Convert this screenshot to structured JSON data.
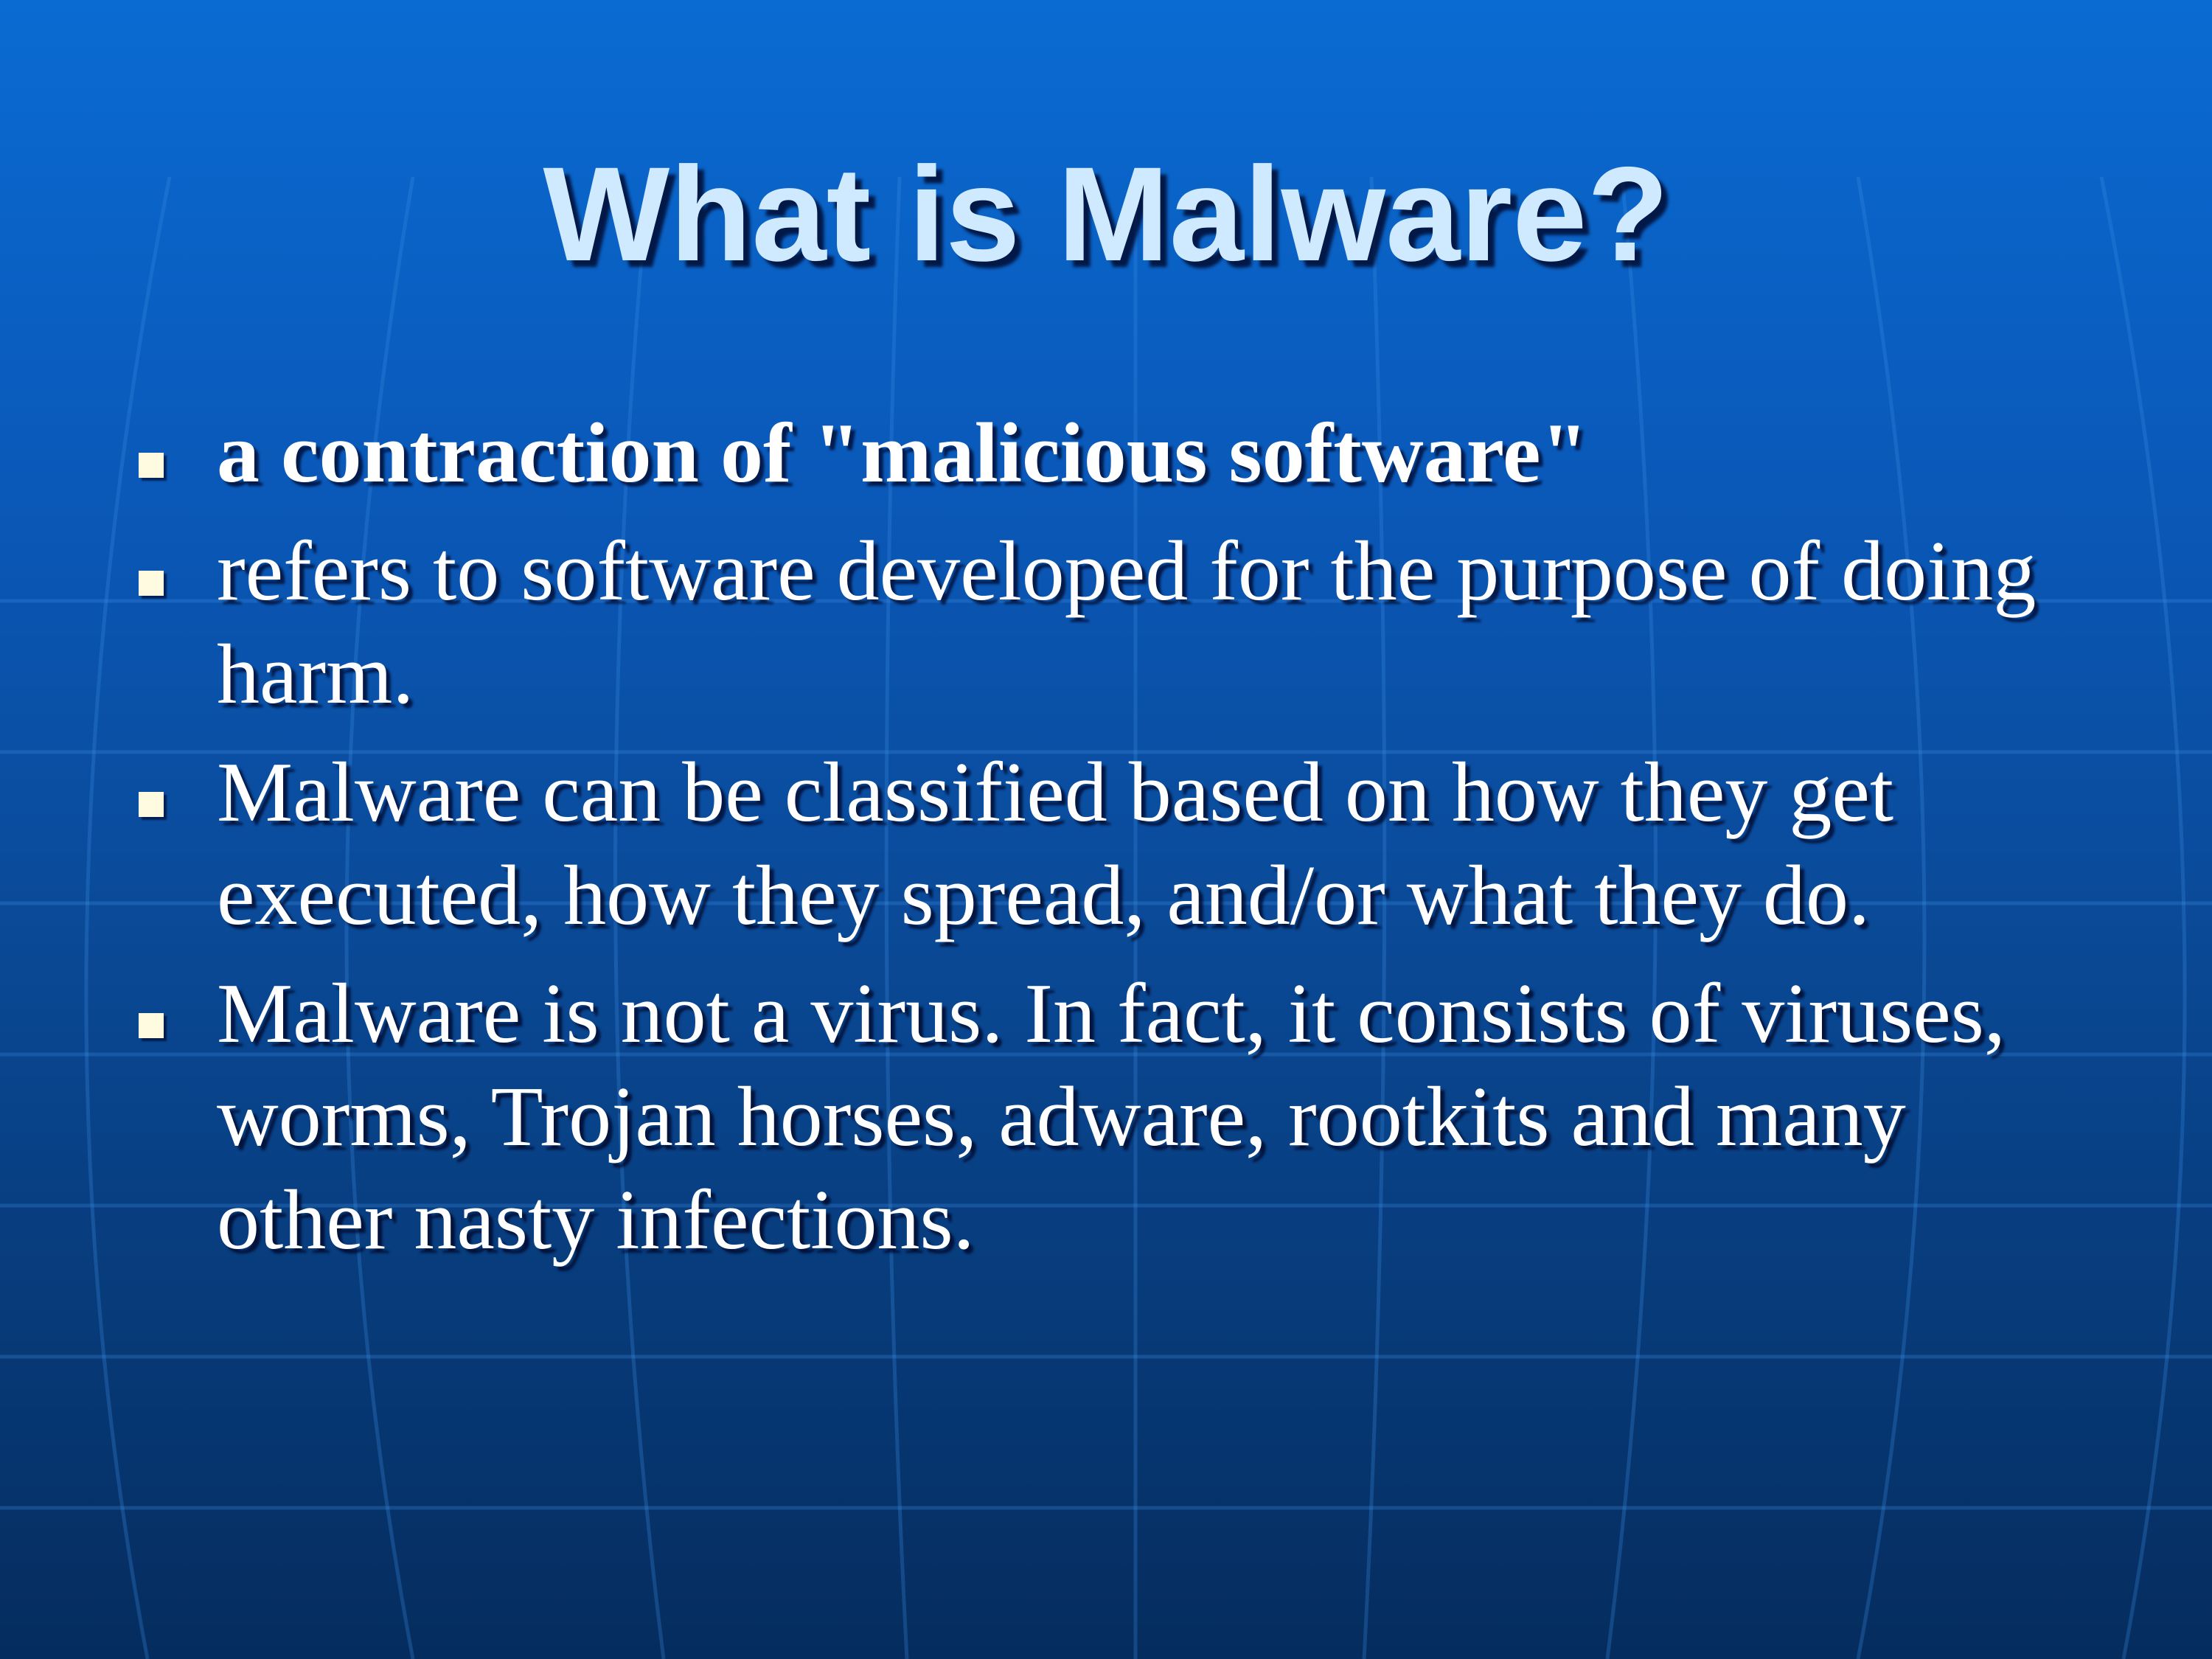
{
  "slide": {
    "title": "What is Malware?",
    "bullets": [
      "a contraction of \"malicious software\"",
      "refers to software developed for the purpose of doing harm.",
      "Malware can be classified based on how they get executed, how they spread, and/or what they do.",
      "Malware is not a virus. In fact, it consists of viruses, worms, Trojan horses, adware, rootkits and many other nasty infections."
    ]
  },
  "theme": {
    "background_top": "#0a6bd2",
    "background_bottom": "#052c5e",
    "title_color": "#cfeaff",
    "text_color": "#ffffff",
    "bullet_color": "#fffbe0",
    "bullet_icon": "square-bullet-icon"
  }
}
